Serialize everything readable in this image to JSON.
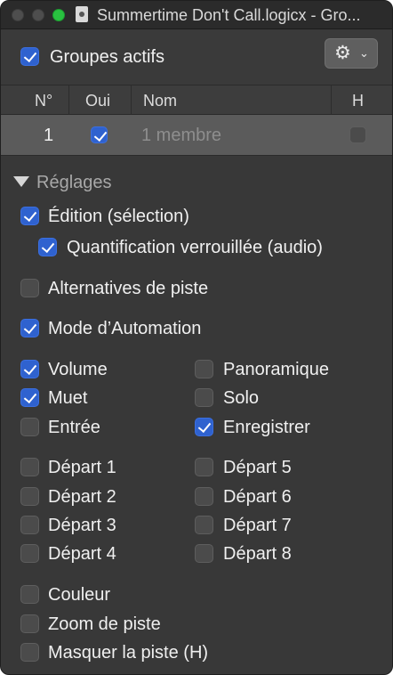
{
  "window": {
    "title": "Summertime Don't Call.logicx - Gro..."
  },
  "header": {
    "active_groups_label": "Groupes actifs",
    "active_groups_checked": true,
    "gear_icon": "gear-icon",
    "chevron_icon": "chevron-down-icon"
  },
  "table": {
    "columns": [
      "N°",
      "Oui",
      "Nom",
      "H"
    ],
    "rows": [
      {
        "num": "1",
        "oui": true,
        "nom": "1 membre",
        "h": false
      }
    ]
  },
  "settings": {
    "title": "Réglages",
    "items": [
      {
        "label": "Édition (sélection)",
        "checked": true
      },
      {
        "label": "Quantification verrouillée (audio)",
        "checked": true
      },
      {
        "label": "Alternatives de piste",
        "checked": false
      },
      {
        "label": "Mode d’Automation",
        "checked": true
      },
      {
        "label": "Volume",
        "checked": true
      },
      {
        "label": "Panoramique",
        "checked": false
      },
      {
        "label": "Muet",
        "checked": true
      },
      {
        "label": "Solo",
        "checked": false
      },
      {
        "label": "Entrée",
        "checked": false
      },
      {
        "label": "Enregistrer",
        "checked": true
      },
      {
        "label": "Départ 1",
        "checked": false
      },
      {
        "label": "Départ 5",
        "checked": false
      },
      {
        "label": "Départ 2",
        "checked": false
      },
      {
        "label": "Départ 6",
        "checked": false
      },
      {
        "label": "Départ 3",
        "checked": false
      },
      {
        "label": "Départ 7",
        "checked": false
      },
      {
        "label": "Départ 4",
        "checked": false
      },
      {
        "label": "Départ 8",
        "checked": false
      },
      {
        "label": "Couleur",
        "checked": false
      },
      {
        "label": "Zoom de piste",
        "checked": false
      },
      {
        "label": "Masquer la piste (H)",
        "checked": false
      }
    ]
  },
  "colors": {
    "accent": "#2f62cf",
    "background": "#383838",
    "selected_row": "#5b5b5b"
  }
}
